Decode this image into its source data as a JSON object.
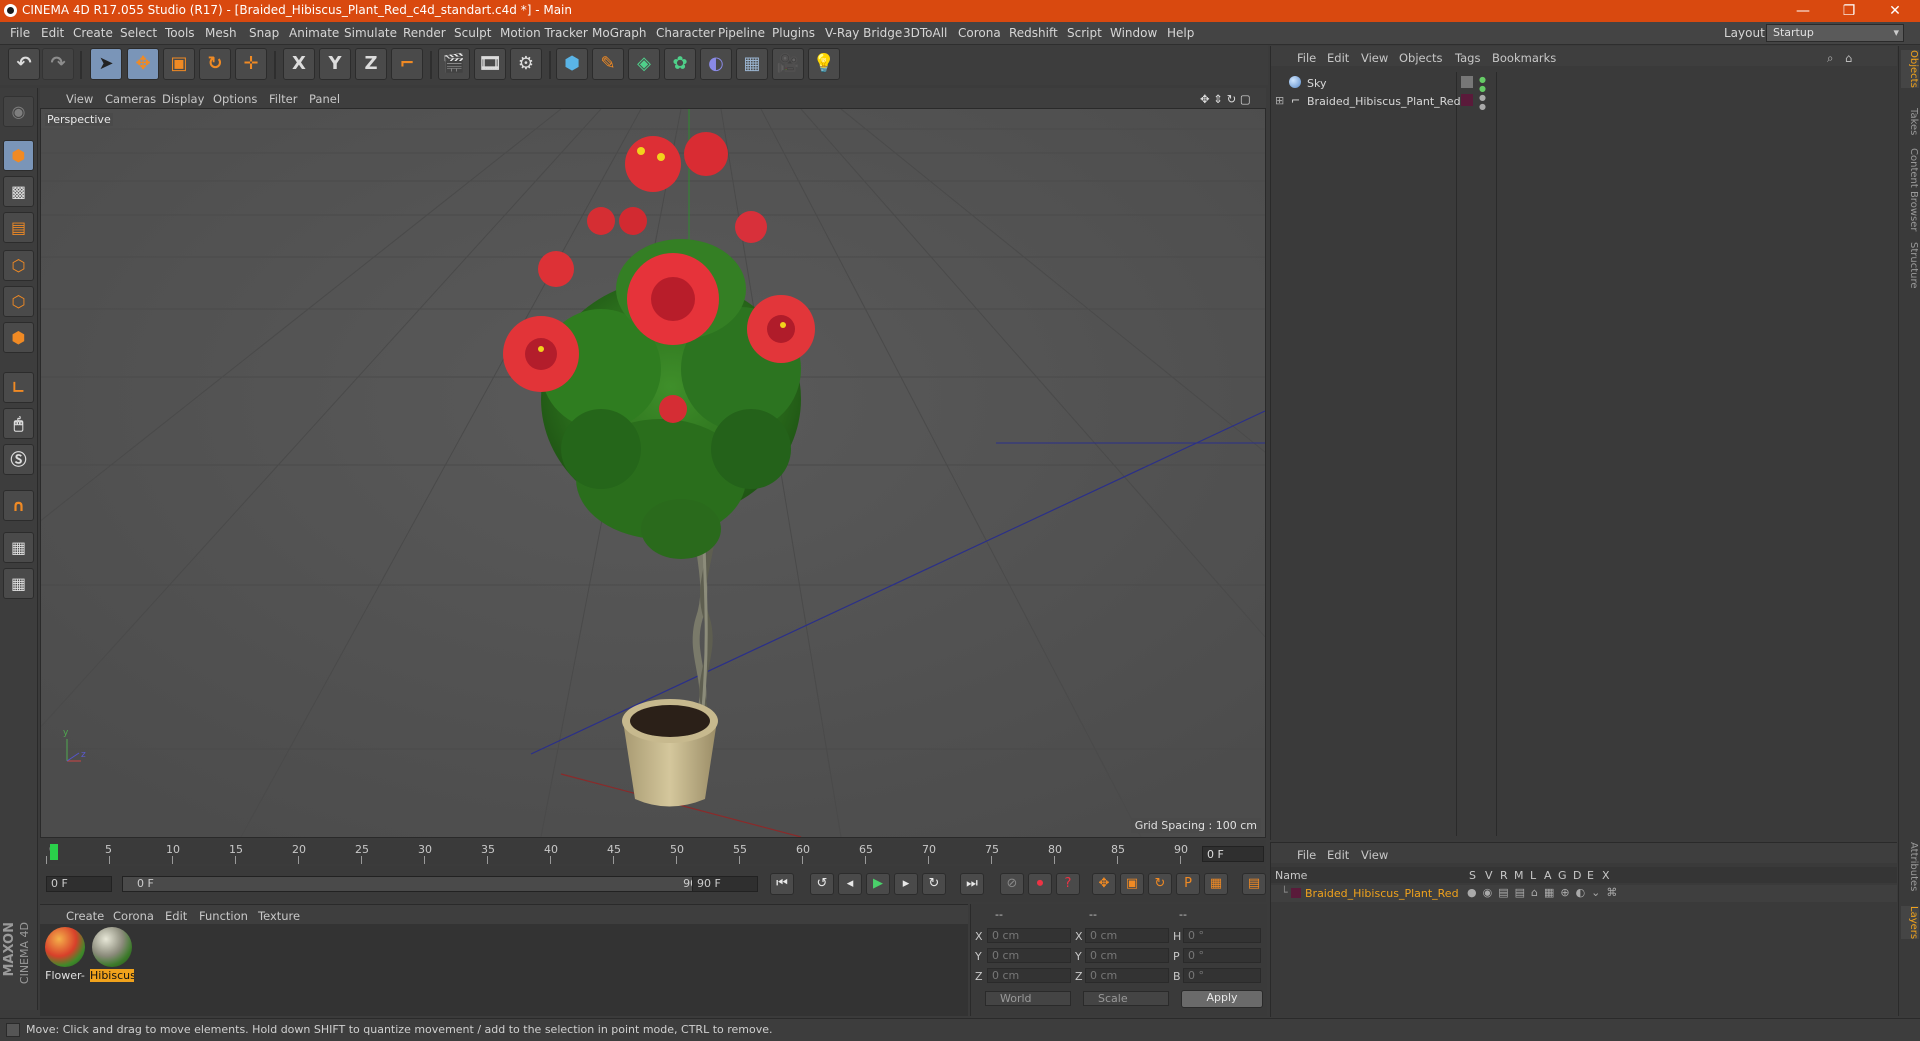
{
  "window": {
    "title": "CINEMA 4D R17.055 Studio (R17) - [Braided_Hibiscus_Plant_Red_c4d_standart.c4d *] - Main",
    "minimize": "—",
    "restore": "❐",
    "close": "✕"
  },
  "menubar": {
    "items": [
      "File",
      "Edit",
      "Create",
      "Select",
      "Tools",
      "Mesh",
      "Snap",
      "Animate",
      "Simulate",
      "Render",
      "Sculpt",
      "Motion Tracker",
      "MoGraph",
      "Character",
      "Pipeline",
      "Plugins",
      "V-Ray Bridge",
      "3DToAll",
      "Corona",
      "Redshift",
      "Script",
      "Window",
      "Help"
    ],
    "layout_label": "Layout:",
    "layout_value": "Startup"
  },
  "toolbar": {
    "axis_x": "X",
    "axis_y": "Y",
    "axis_z": "Z"
  },
  "viewport": {
    "menu": [
      "View",
      "Cameras",
      "Display",
      "Options",
      "Filter",
      "Panel"
    ],
    "label": "Perspective",
    "grid_spacing": "Grid Spacing : 100 cm",
    "axis_y": "y",
    "axis_z": "z"
  },
  "timeline": {
    "ticks": [
      "0",
      "5",
      "10",
      "15",
      "20",
      "25",
      "30",
      "35",
      "40",
      "45",
      "50",
      "55",
      "60",
      "65",
      "70",
      "75",
      "80",
      "85",
      "90"
    ],
    "current_frame": "0 F"
  },
  "transport": {
    "start_field": "0 F",
    "range_start": "0 F",
    "range_end": "90 F",
    "end_field": "90 F"
  },
  "materials": {
    "menu": [
      "Create",
      "Corona",
      "Edit",
      "Function",
      "Texture"
    ],
    "items": [
      {
        "label": "Flower-"
      },
      {
        "label": "Hibiscus"
      }
    ]
  },
  "coords": {
    "head": [
      "--",
      "--",
      "--"
    ],
    "rows": [
      {
        "l1": "X",
        "v1": "0 cm",
        "l2": "X",
        "v2": "0 cm",
        "l3": "H",
        "v3": "0 °"
      },
      {
        "l1": "Y",
        "v1": "0 cm",
        "l2": "Y",
        "v2": "0 cm",
        "l3": "P",
        "v3": "0 °"
      },
      {
        "l1": "Z",
        "v1": "0 cm",
        "l2": "Z",
        "v2": "0 cm",
        "l3": "B",
        "v3": "0 °"
      }
    ],
    "mode1": "World",
    "mode2": "Scale",
    "apply": "Apply"
  },
  "object_manager": {
    "menu": [
      "File",
      "Edit",
      "View",
      "Objects",
      "Tags",
      "Bookmarks"
    ],
    "objects": [
      {
        "name": "Sky"
      },
      {
        "name": "Braided_Hibiscus_Plant_Red"
      }
    ]
  },
  "layer_manager": {
    "menu": [
      "File",
      "Edit",
      "View"
    ],
    "name_header": "Name",
    "columns": [
      "S",
      "V",
      "R",
      "M",
      "L",
      "A",
      "G",
      "D",
      "E",
      "X"
    ],
    "layer_name": "Braided_Hibiscus_Plant_Red",
    "layer_color": "#5a1a3a"
  },
  "side_tabs": [
    "Objects",
    "Takes",
    "Content Browser",
    "Structure",
    "Attributes",
    "Layers"
  ],
  "status": "Move: Click and drag to move elements. Hold down SHIFT to quantize movement / add to the selection in point mode, CTRL to remove.",
  "logo": {
    "maxon": "MAXON",
    "c4d": "CINEMA 4D"
  },
  "colors": {
    "title_bar": "#d9490f",
    "accent": "#f0a21c",
    "selected_tool": "#7a95b8"
  }
}
